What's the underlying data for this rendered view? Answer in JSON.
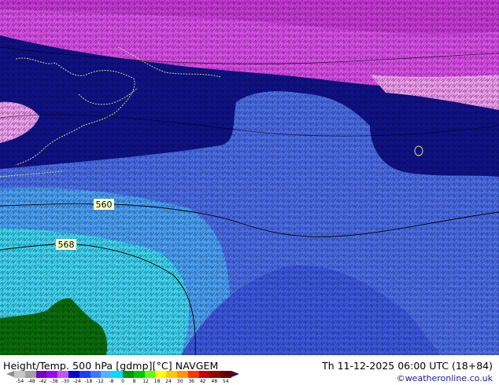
{
  "map": {
    "contour_labels": [
      "560",
      "568"
    ]
  },
  "footer": {
    "title": "Height/Temp. 500 hPa [gdmp][°C] NAVGEM",
    "datetime": "Th 11-12-2025 06:00 UTC (18+84)",
    "credit": "©weatheronline.co.uk"
  },
  "colorbar": {
    "ticks": [
      "-54",
      "-48",
      "-42",
      "-38",
      "-30",
      "-24",
      "-18",
      "-12",
      "-8",
      "0",
      "8",
      "12",
      "18",
      "24",
      "30",
      "36",
      "42",
      "48",
      "54"
    ],
    "colors": [
      "#c8c8c8",
      "#a0a0a0",
      "#7800c8",
      "#a000ff",
      "#c850ff",
      "#0000c8",
      "#1e3cff",
      "#3c78ff",
      "#50b4ff",
      "#00dcff",
      "#009600",
      "#00c800",
      "#64ff00",
      "#ffff00",
      "#ffc800",
      "#ff9600",
      "#ff3200",
      "#c80000",
      "#960000",
      "#640000"
    ]
  },
  "colors": {
    "magenta": "#e060f0",
    "pink": "#f0a0f0",
    "dark_blue": "#10108a",
    "medium_blue": "#4060e8",
    "light_blue": "#4aa0f5",
    "cyan": "#40d8f0",
    "green": "#0a6e0a"
  }
}
